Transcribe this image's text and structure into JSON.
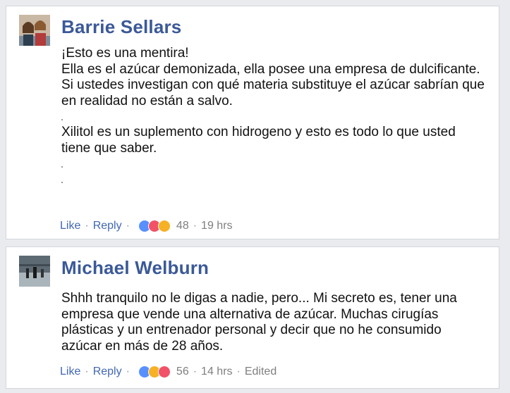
{
  "comments": [
    {
      "author": "Barrie Sellars",
      "paragraphs": [
        "¡Esto es una mentira!\nElla es el azúcar demonizada, ella posee una empresa de dulcificante.\nSi ustedes investigan con qué materia substituye el azúcar sabrían que en realidad no están a salvo.",
        "Xilitol es un suplemento con hidrogeno y esto es todo lo que usted tiene que saber."
      ],
      "like_label": "Like",
      "reply_label": "Reply",
      "reactions": [
        "like",
        "love",
        "haha"
      ],
      "reaction_count": "48",
      "time": "19 hrs"
    },
    {
      "author": "Michael Welburn",
      "paragraphs": [
        "Shhh tranquilo no le digas a nadie, pero... Mi secreto es, tener una empresa que vende una alternativa de azúcar. Muchas cirugías plásticas y un entrenador personal y decir que no he consumido azúcar en más de 28 años."
      ],
      "like_label": "Like",
      "reply_label": "Reply",
      "reactions": [
        "like",
        "haha",
        "love"
      ],
      "reaction_count": "56",
      "time": "14 hrs",
      "edited_label": "Edited"
    }
  ],
  "colors": {
    "author": "#3b5998",
    "link": "#4267b2",
    "meta": "#7f7f7f",
    "like": "#5890ff",
    "love": "#f25268",
    "haha": "#f7b125"
  }
}
